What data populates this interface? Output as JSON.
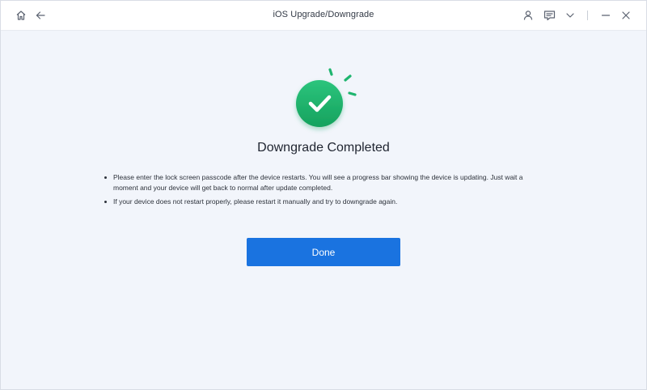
{
  "window": {
    "title": "iOS Upgrade/Downgrade"
  },
  "titlebar": {
    "icons": [
      "home-icon",
      "back-arrow-icon",
      "account-icon",
      "feedback-icon",
      "chevron-down-icon",
      "minimize-icon",
      "close-icon"
    ]
  },
  "result": {
    "status_icon": "check-circle-icon",
    "heading": "Downgrade Completed",
    "notes": [
      "Please enter the lock screen passcode after the device restarts. You will see a progress bar showing the device is updating. Just wait a moment and your device will get back to normal after update completed.",
      "If your device does not restart properly, please restart it manually and try to downgrade again."
    ]
  },
  "actions": {
    "done_label": "Done"
  },
  "colors": {
    "accent": "#1a73e0",
    "success": "#1fb56f",
    "background": "#f2f5fb"
  }
}
